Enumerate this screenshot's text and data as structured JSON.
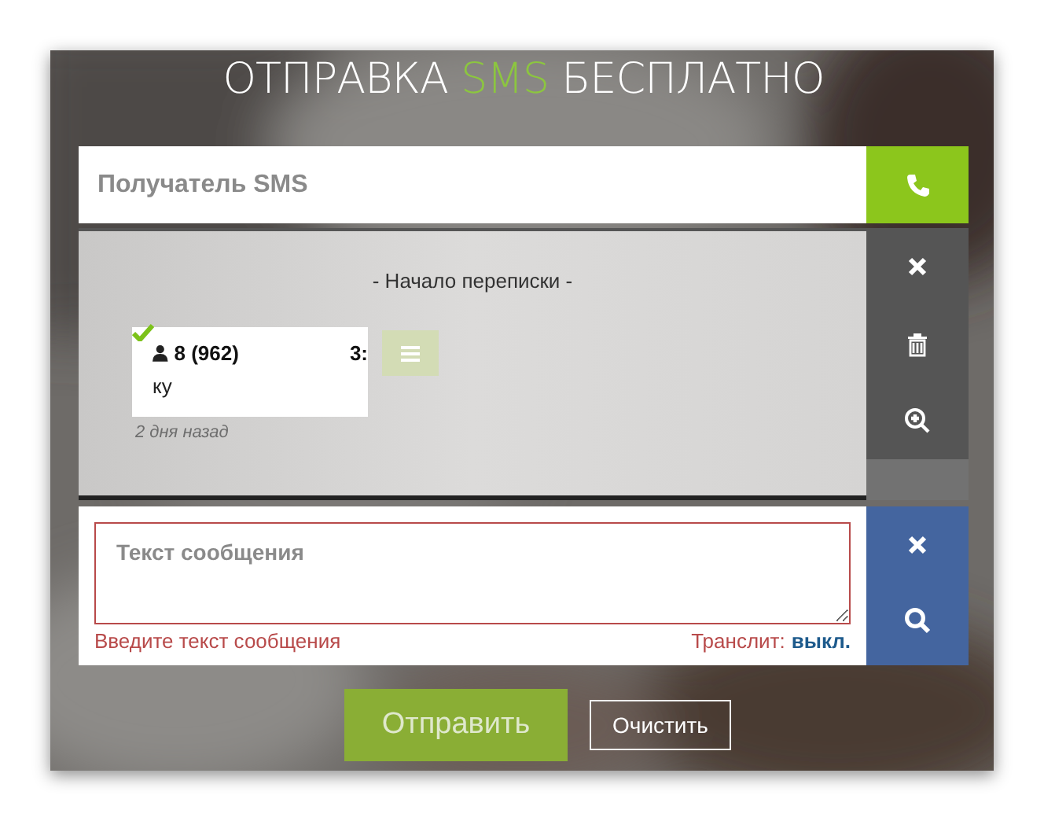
{
  "title": {
    "before": "ОТПРАВКА ",
    "highlight": "SMS",
    "after": " БЕСПЛАТНО"
  },
  "recipient": {
    "placeholder": "Получатель SMS"
  },
  "chat": {
    "start_label": "- Начало переписки -",
    "messages": [
      {
        "sender_start": "8 (962)",
        "sender_end": "3:",
        "text": "ку",
        "time": "2 дня назад",
        "delivered": true
      }
    ]
  },
  "message": {
    "placeholder": "Текст сообщения",
    "error": "Введите текст сообщения",
    "translit_label": "Транслит:",
    "translit_value": "выкл."
  },
  "buttons": {
    "send": "Отправить",
    "clear": "Очистить"
  }
}
